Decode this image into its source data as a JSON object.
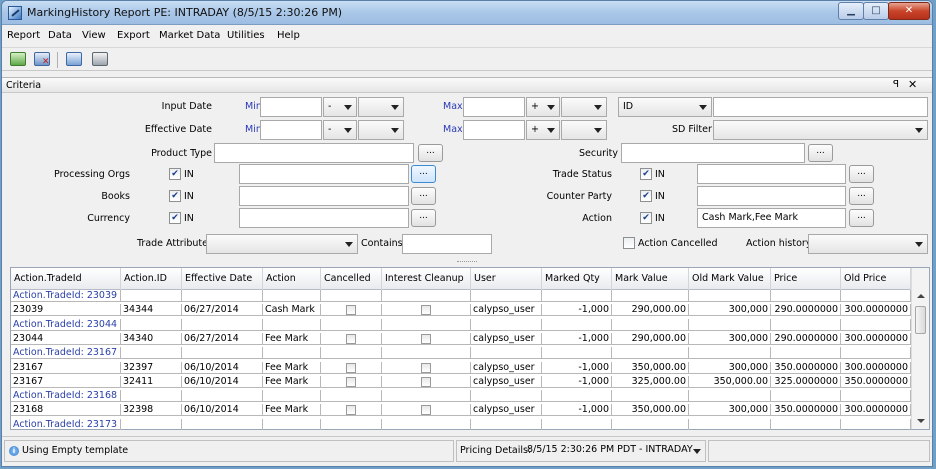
{
  "window": {
    "title": "MarkingHistory Report PE: INTRADAY (8/5/15 2:30:26 PM)"
  },
  "menu": [
    "Report",
    "Data",
    "View",
    "Export",
    "Market Data",
    "Utilities",
    "Help"
  ],
  "toolbar_icons": [
    "load-report-icon",
    "delete-report-icon",
    "save-report-icon",
    "print-icon"
  ],
  "criteria": {
    "panel_title": "Criteria",
    "input_date_label": "Input Date",
    "effective_date_label": "Effective Date",
    "min_label": "Min",
    "max_label": "Max",
    "input_min_sign": "-",
    "input_max_sign": "+",
    "eff_min_sign": "-",
    "eff_max_sign": "+",
    "id_select": "ID",
    "sd_filter_label": "SD Filter",
    "product_type_label": "Product Type",
    "security_label": "Security",
    "processing_orgs_label": "Processing Orgs",
    "books_label": "Books",
    "currency_label": "Currency",
    "in_label": "IN",
    "trade_status_label": "Trade Status",
    "counter_party_label": "Counter Party",
    "action_label": "Action",
    "action_value": "Cash Mark,Fee Mark",
    "trade_attribute_label": "Trade Attribute",
    "contains_label": "Contains",
    "action_cancelled_label": "Action Cancelled",
    "action_history_label": "Action history",
    "ellipsis": "..."
  },
  "grid": {
    "columns": [
      "Action.TradeId",
      "Action.ID",
      "Effective Date",
      "Action",
      "Cancelled",
      "Interest Cleanup",
      "User",
      "Marked Qty",
      "Mark Value",
      "Old Mark Value",
      "Price",
      "Old Price"
    ],
    "rows": [
      {
        "group": "Action.TradeId: 23039"
      },
      {
        "cells": [
          "23039",
          "34344",
          "06/27/2014",
          "Cash Mark",
          "",
          "",
          "calypso_user",
          "-1,000",
          "290,000.00",
          "300,000",
          "290.0000000",
          "300.0000000"
        ]
      },
      {
        "group": "Action.TradeId: 23044"
      },
      {
        "cells": [
          "23044",
          "34340",
          "06/27/2014",
          "Fee Mark",
          "",
          "",
          "calypso_user",
          "-1,000",
          "290,000.00",
          "300,000",
          "290.0000000",
          "300.0000000"
        ]
      },
      {
        "group": "Action.TradeId: 23167"
      },
      {
        "cells": [
          "23167",
          "32397",
          "06/10/2014",
          "Fee Mark",
          "",
          "",
          "calypso_user",
          "-1,000",
          "350,000.00",
          "300,000",
          "350.0000000",
          "300.0000000"
        ]
      },
      {
        "cells": [
          "23167",
          "32411",
          "06/10/2014",
          "Fee Mark",
          "",
          "",
          "calypso_user",
          "-1,000",
          "325,000.00",
          "350,000.00",
          "325.0000000",
          "350.0000000"
        ]
      },
      {
        "group": "Action.TradeId: 23168"
      },
      {
        "cells": [
          "23168",
          "32398",
          "06/10/2014",
          "Fee Mark",
          "",
          "",
          "calypso_user",
          "-1,000",
          "350,000.00",
          "300,000",
          "350.0000000",
          "300.0000000"
        ]
      },
      {
        "group": "Action.TradeId: 23173"
      }
    ]
  },
  "status": {
    "message": "Using Empty template",
    "pricing_label": "Pricing Details:",
    "pricing_value": "8/5/15 2:30:26 PM PDT - INTRADAY"
  }
}
